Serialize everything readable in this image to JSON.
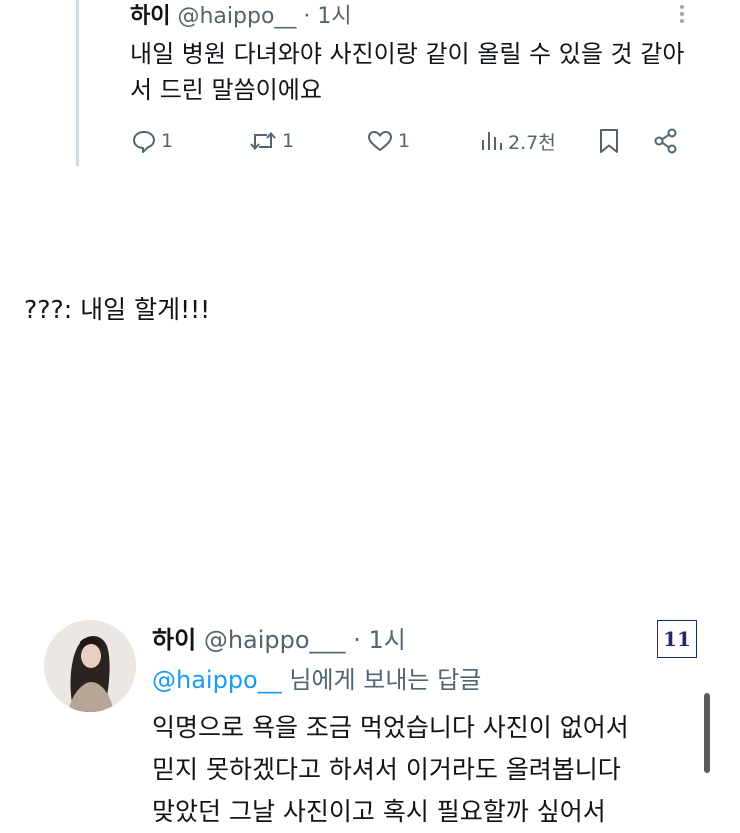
{
  "top_tweet": {
    "name": "하이",
    "handle": "@haippo__",
    "separator": "·",
    "time": "1시",
    "text": "내일 병원 다녀와야 사진이랑 같이 올릴 수 있을 것 같아서 드린 말씀이에요",
    "actions": {
      "reply_count": "1",
      "retweet_count": "1",
      "like_count": "1",
      "views_count": "2.7천"
    }
  },
  "caption": "???: 내일 할게!!!",
  "reply_tweet": {
    "name": "하이",
    "handle": "@haippo___",
    "separator": "·",
    "time": "1시",
    "replying_to_handle": "@haippo__",
    "replying_to_suffix": " 님에게 보내는 답글",
    "text_lines": [
      "익명으로 욕을 조금 먹었습니다 사진이 없어서",
      "믿지 못하겠다고 하셔서 이거라도 올려봅니다",
      "맞았던 그날 사진이고 혹시 필요할까 싶어서"
    ],
    "badge": "11"
  },
  "icons": {
    "menu": "more-vertical-icon",
    "reply": "speech-bubble-icon",
    "retweet": "retweet-arrows-icon",
    "like": "heart-icon",
    "views": "bar-chart-icon",
    "bookmark": "bookmark-icon",
    "share": "share-nodes-icon"
  },
  "colors": {
    "text": "#0f1419",
    "secondary": "#536471",
    "link": "#1d9bf0",
    "badge": "#1d2a6b"
  }
}
